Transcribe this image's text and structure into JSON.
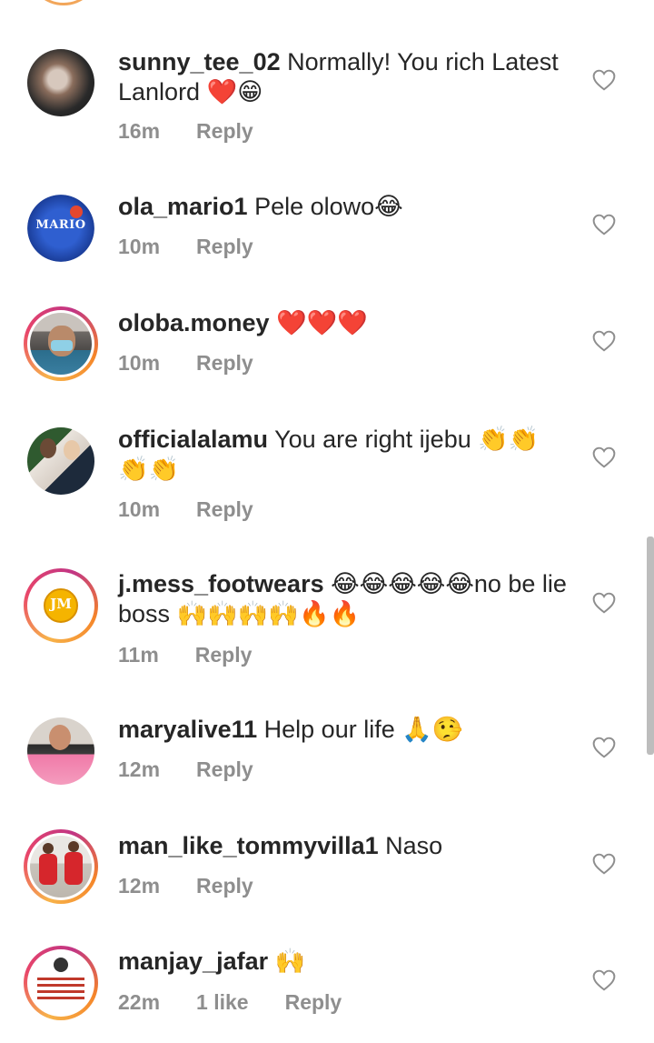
{
  "comments": [
    {
      "username": "sunny_tee_02",
      "text": "Normally! You rich Latest Lanlord ❤️😁",
      "time": "16m",
      "likes": "",
      "reply": "Reply"
    },
    {
      "username": "ola_mario1",
      "text": "Pele olowo😂",
      "time": "10m",
      "likes": "",
      "reply": "Reply",
      "avatar_label": "MARIO"
    },
    {
      "username": "oloba.money",
      "text": "❤️❤️❤️",
      "time": "10m",
      "likes": "",
      "reply": "Reply"
    },
    {
      "username": "officialalamu",
      "text": "You are right ijebu 👏👏 👏👏",
      "time": "10m",
      "likes": "",
      "reply": "Reply"
    },
    {
      "username": "j.mess_footwears",
      "text": "😂😂😂😂😂no be lie boss 🙌🙌🙌🙌🔥🔥",
      "time": "11m",
      "likes": "",
      "reply": "Reply",
      "avatar_label": "JM"
    },
    {
      "username": "maryalive11",
      "text": "Help our life 🙏🤥",
      "time": "12m",
      "likes": "",
      "reply": "Reply"
    },
    {
      "username": "man_like_tommyvilla1",
      "text": "Naso",
      "time": "12m",
      "likes": "",
      "reply": "Reply"
    },
    {
      "username": "manjay_jafar",
      "text": "🙌",
      "time": "22m",
      "likes": "1 like",
      "reply": "Reply"
    }
  ],
  "icons": {
    "like": "heart-outline-icon"
  },
  "colors": {
    "meta_text": "#8e8e8e",
    "story_ring_start": "#f7b34a",
    "story_ring_end": "#c13584"
  }
}
